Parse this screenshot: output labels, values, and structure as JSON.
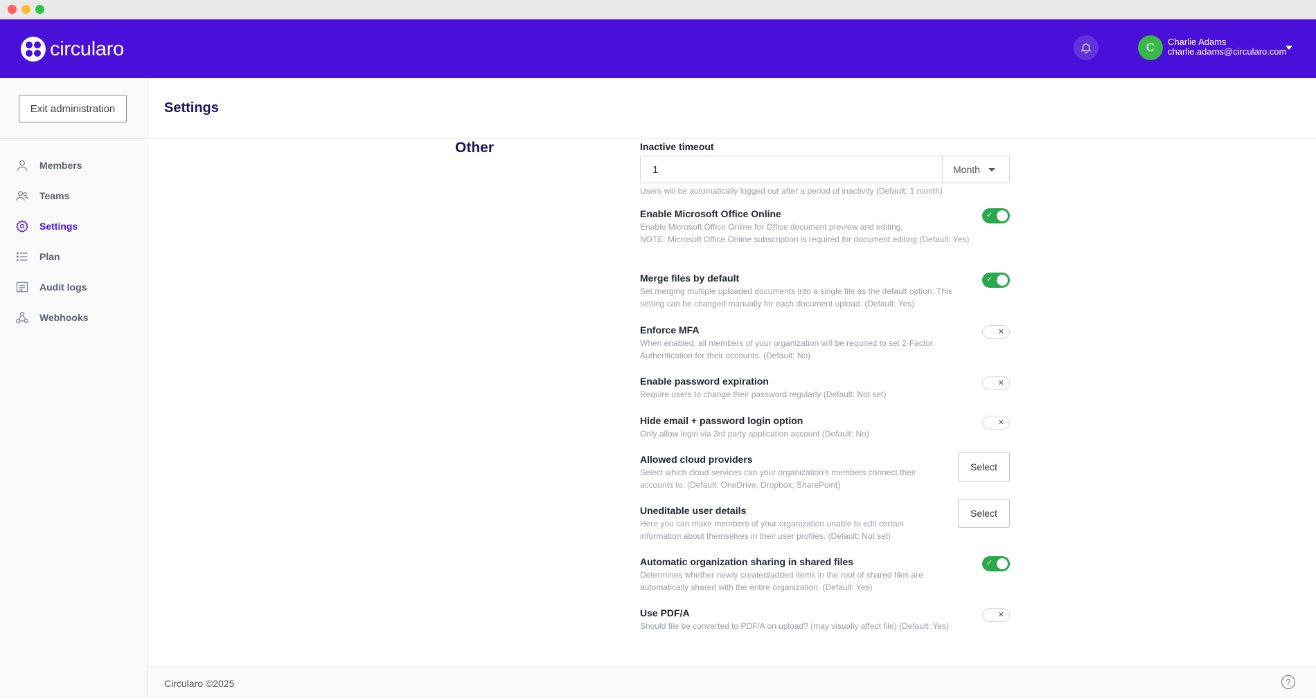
{
  "app": {
    "name": "circularo"
  },
  "user": {
    "initial": "C",
    "name": "Charlie Adams",
    "email": "charlie.adams@circularo.com"
  },
  "sidebar": {
    "exit_label": "Exit administration",
    "items": [
      {
        "label": "Members",
        "icon": "user-icon"
      },
      {
        "label": "Teams",
        "icon": "users-icon"
      },
      {
        "label": "Settings",
        "icon": "gear-icon"
      },
      {
        "label": "Plan",
        "icon": "list-icon"
      },
      {
        "label": "Audit logs",
        "icon": "log-icon"
      },
      {
        "label": "Webhooks",
        "icon": "webhook-icon"
      }
    ]
  },
  "page": {
    "title": "Settings",
    "section": "Other"
  },
  "settings": {
    "inactive_timeout": {
      "label": "Inactive timeout",
      "value": "1",
      "unit": "Month",
      "desc": "Users will be automatically logged out after a period of inactivity  (Default: 1 month)"
    },
    "office_online": {
      "label": "Enable Microsoft Office Online",
      "desc": "Enable Microsoft Office Online for Office document preview and editing.\nNOTE: Microsoft Office Online subscription is required for document editing  (Default: Yes)",
      "enabled": true
    },
    "merge_files": {
      "label": "Merge files by default",
      "desc": "Set merging multiple uploaded documents into a single file as the default option. This setting can be changed manually for each document upload.  (Default: Yes)",
      "enabled": true
    },
    "enforce_mfa": {
      "label": "Enforce MFA",
      "desc": "When enabled, all members of your organization will be required to set 2-Factor Authentication for their accounts.  (Default: No)",
      "enabled": false
    },
    "password_expiration": {
      "label": "Enable password expiration",
      "desc": "Require users to change their password regularly  (Default: Not set)",
      "enabled": false
    },
    "hide_email_login": {
      "label": "Hide email + password login option",
      "desc": "Only allow login via 3rd party application account  (Default: No)",
      "enabled": false
    },
    "cloud_providers": {
      "label": "Allowed cloud providers",
      "desc": "Select which cloud services can your organization's members connect their accounts to.  (Default: OneDrive, Dropbox, SharePoint)",
      "button": "Select"
    },
    "uneditable_details": {
      "label": "Uneditable user details",
      "desc": "Here you can make members of your organization unable to edit certain information about themselves in their user profiles.  (Default: Not set)",
      "button": "Select"
    },
    "auto_sharing": {
      "label": "Automatic organization sharing in shared files",
      "desc": "Determines whether newly created/added items in the root of shared files are automatically shared with the entire organization.  (Default: Yes)",
      "enabled": true
    },
    "pdfa": {
      "label": "Use PDF/A",
      "desc": "Should file be converted to PDF/A on upload? (may visually affect file)  (Default: Yes)",
      "enabled": false
    }
  },
  "footer": {
    "text": "Circularo ©2025",
    "help": "?"
  },
  "colors": {
    "brand": "#4a10d9",
    "toggle_on": "#2aa84c",
    "avatar": "#3ab84a"
  }
}
